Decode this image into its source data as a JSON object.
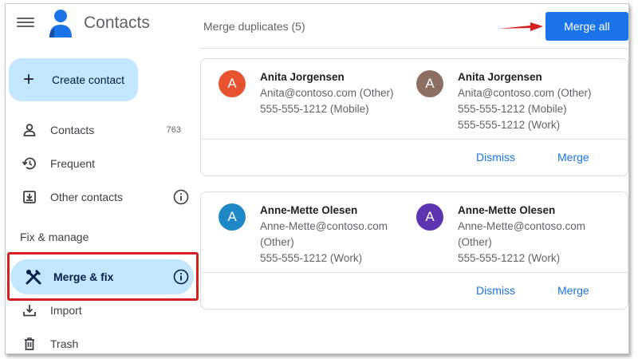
{
  "app": {
    "title": "Contacts"
  },
  "sidebar": {
    "create_label": "Create contact",
    "nav": [
      {
        "label": "Contacts",
        "count": "763",
        "icon": "person-icon"
      },
      {
        "label": "Frequent",
        "icon": "history-icon"
      },
      {
        "label": "Other contacts",
        "icon": "download-box-icon"
      }
    ],
    "section_label": "Fix & manage",
    "merge_fix_label": "Merge & fix",
    "import_label": "Import",
    "trash_label": "Trash"
  },
  "main": {
    "title": "Merge duplicates (5)",
    "merge_all_label": "Merge all",
    "cards": [
      {
        "left": {
          "initial": "A",
          "name": "Anita Jorgensen",
          "lines": [
            "Anita@contoso.com (Other)",
            "555-555-1212 (Mobile)"
          ],
          "color": "#e8532f"
        },
        "right": {
          "initial": "A",
          "name": "Anita Jorgensen",
          "lines": [
            "Anita@contoso.com (Other)",
            "555-555-1212 (Mobile)",
            "555-555-1212 (Work)"
          ],
          "color": "#8d6e63"
        },
        "dismiss_label": "Dismiss",
        "merge_label": "Merge"
      },
      {
        "left": {
          "initial": "A",
          "name": "Anne-Mette Olesen",
          "lines": [
            "Anne-Mette@contoso.com",
            "(Other)",
            "555-555-1212 (Work)"
          ],
          "color": "#1e88c7"
        },
        "right": {
          "initial": "A",
          "name": "Anne-Mette Olesen",
          "lines": [
            "Anne-Mette@contoso.com",
            "(Other)",
            "555-555-1212 (Work)"
          ],
          "color": "#5e35b1"
        },
        "dismiss_label": "Dismiss",
        "merge_label": "Merge"
      }
    ]
  },
  "colors": {
    "accent": "#1a73e8",
    "highlight": "#c2e7ff",
    "annotation_red": "#d62020"
  }
}
